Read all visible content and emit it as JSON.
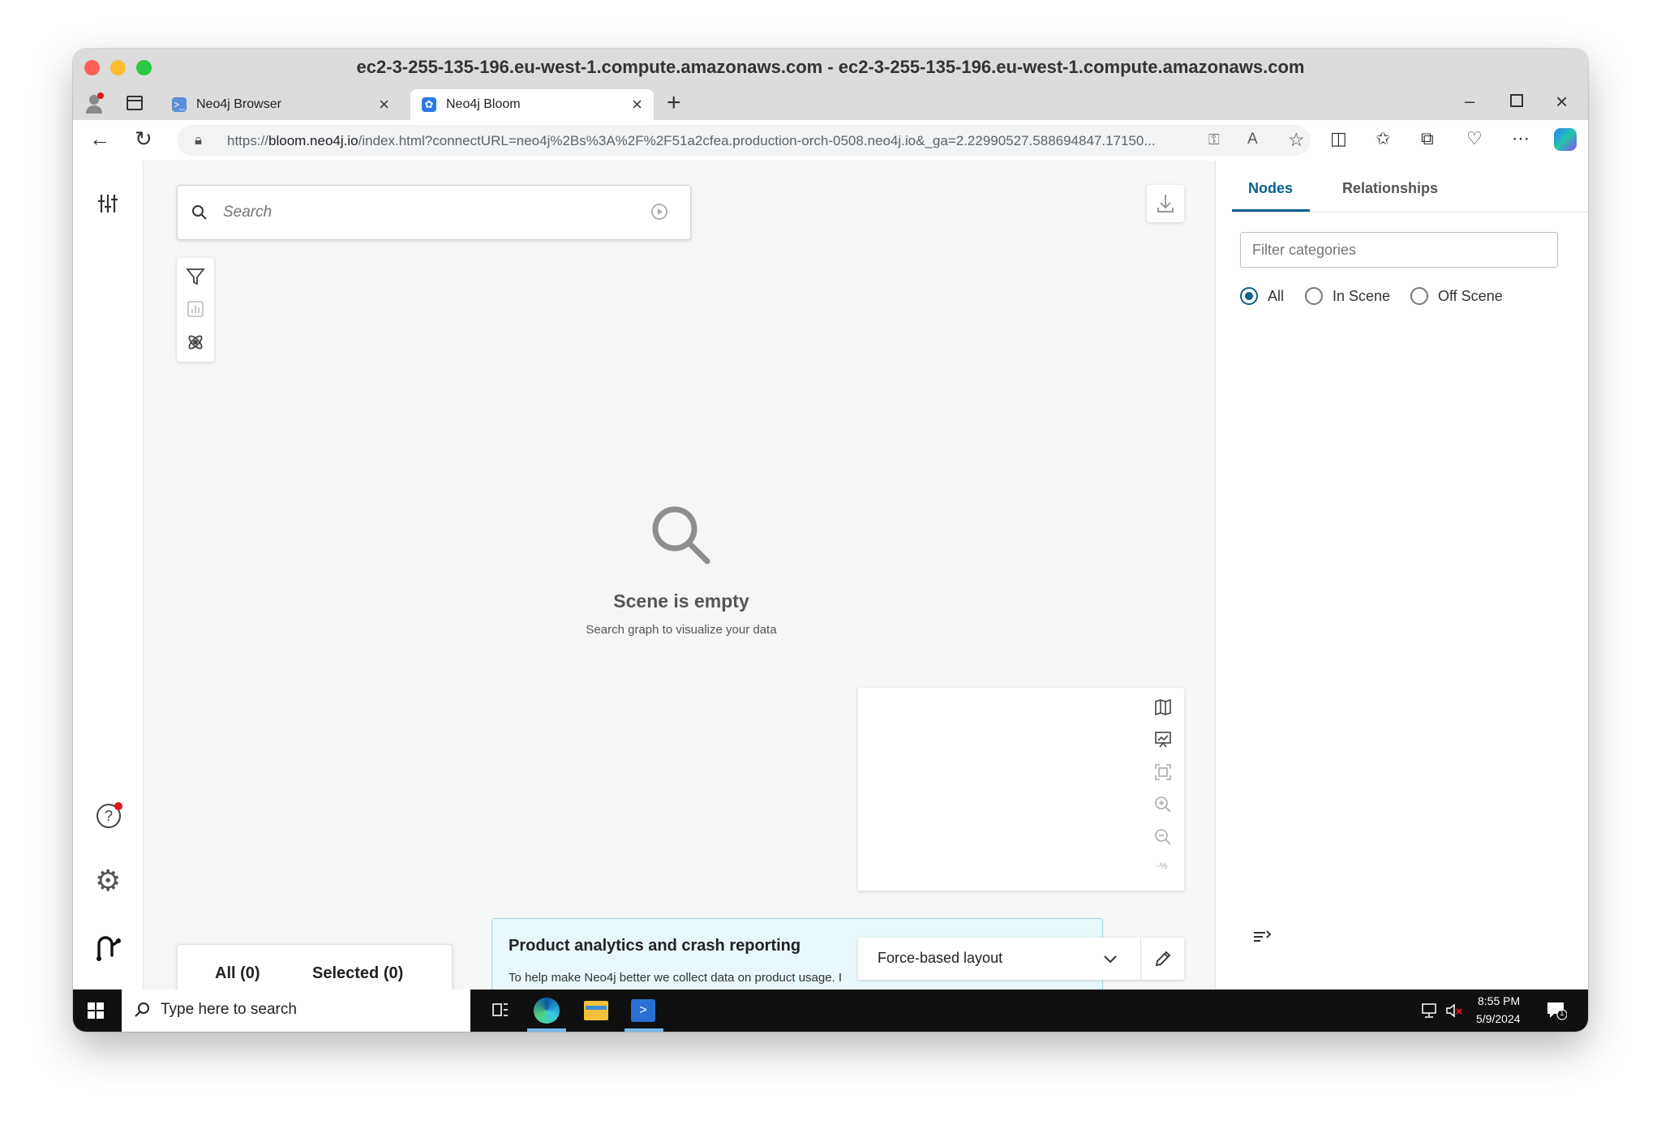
{
  "window": {
    "title": "ec2-3-255-135-196.eu-west-1.compute.amazonaws.com - ec2-3-255-135-196.eu-west-1.compute.amazonaws.com"
  },
  "browser": {
    "tabs": [
      {
        "label": "Neo4j Browser",
        "icon": "neo4j-browser-icon",
        "active": false
      },
      {
        "label": "Neo4j Bloom",
        "icon": "neo4j-bloom-icon",
        "active": true
      }
    ],
    "url_prefix": "https://",
    "url_host": "bloom.neo4j.io",
    "url_rest": "/index.html?connectURL=neo4j%2Bs%3A%2F%2F51a2cfea.production-orch-0508.neo4j.io&_ga=2.22990527.588694847.17150..."
  },
  "search": {
    "placeholder": "Search"
  },
  "empty_state": {
    "title": "Scene is empty",
    "subtitle": "Search graph to visualize your data"
  },
  "selection": {
    "all_label": "All (0)",
    "selected_label": "Selected (0)"
  },
  "analytics_banner": {
    "title": "Product analytics and crash reporting",
    "body": "To help make Neo4j better we collect data on product usage. I"
  },
  "layout": {
    "selected": "Force-based layout"
  },
  "right_panel": {
    "tabs": [
      {
        "label": "Nodes",
        "active": true
      },
      {
        "label": "Relationships",
        "active": false
      }
    ],
    "filter_placeholder": "Filter categories",
    "scope_options": [
      {
        "label": "All",
        "checked": true
      },
      {
        "label": "In Scene",
        "checked": false
      },
      {
        "label": "Off Scene",
        "checked": false
      }
    ]
  },
  "zoom_panel": {
    "zoom_readout": "-%"
  },
  "taskbar": {
    "search_placeholder": "Type here to search",
    "time": "8:55 PM",
    "date": "5/9/2024",
    "notification_count": "1"
  },
  "colors": {
    "accent": "#0a6190",
    "close_red": "#ff5f57",
    "minimize_yellow": "#febc2e",
    "zoom_green": "#28c840",
    "banner_bg": "#e8f7fa",
    "notification_dot": "#e0141e"
  }
}
